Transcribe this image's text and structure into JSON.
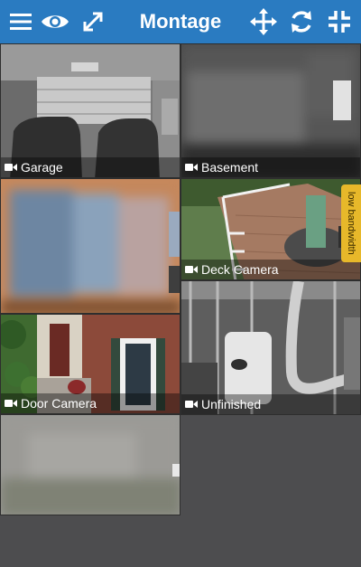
{
  "app": {
    "title": "Montage"
  },
  "toolbar": {
    "icons": [
      "menu-icon",
      "eye-icon",
      "expand-icon",
      "move-icon",
      "refresh-icon",
      "collapse-icon"
    ]
  },
  "badge": {
    "text": "low bandwidth"
  },
  "cameras": {
    "garage": {
      "name": "Garage"
    },
    "basement": {
      "name": "Basement"
    },
    "deck": {
      "name": "Deck Camera"
    },
    "door": {
      "name": "Door Camera"
    },
    "unfinished": {
      "name": "Unfinished"
    }
  },
  "colors": {
    "header": "#2a7bc1",
    "background": "#4d4d4f",
    "badge": "#e7b82a"
  }
}
